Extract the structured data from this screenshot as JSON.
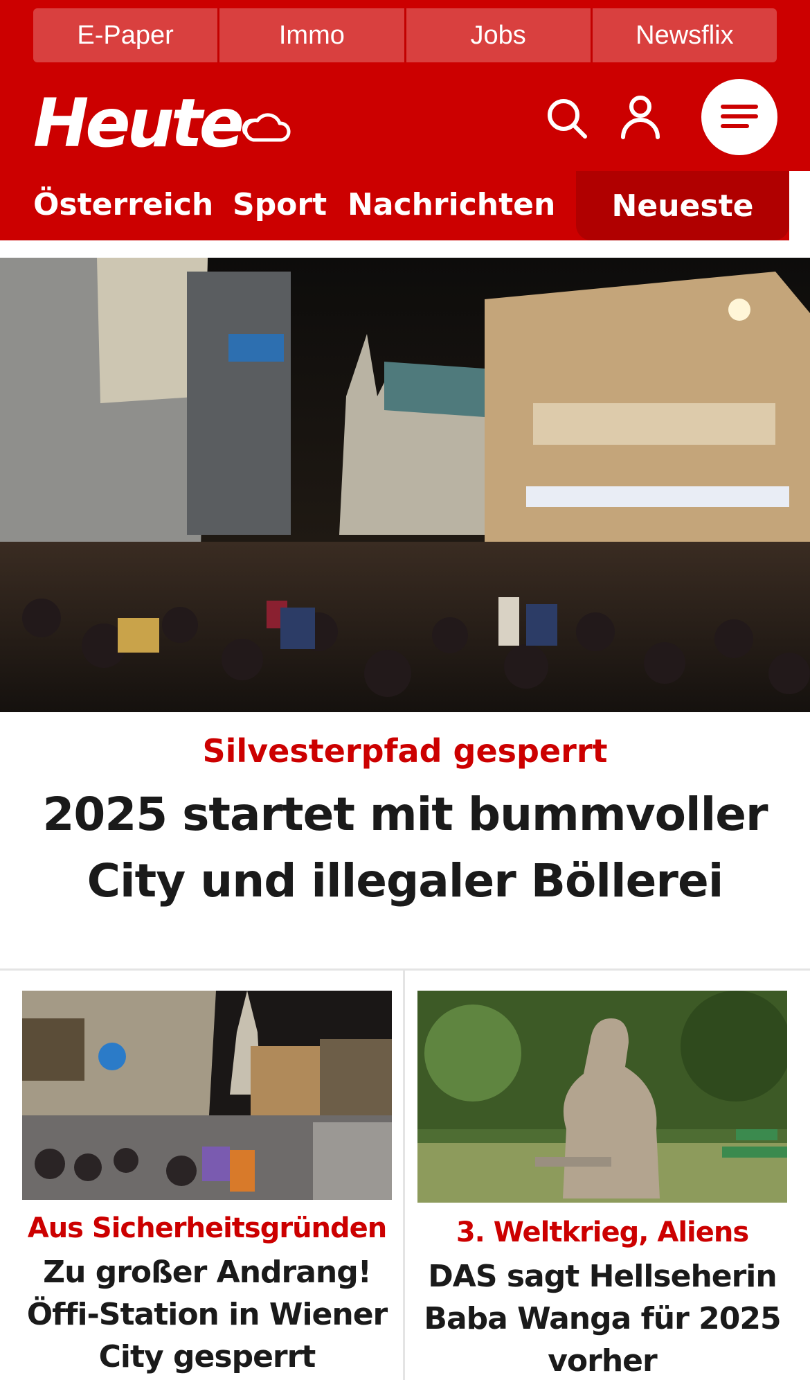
{
  "utility_links": [
    "E-Paper",
    "Immo",
    "Jobs",
    "Newsflix"
  ],
  "brand": {
    "logo_text": "Heute"
  },
  "colors": {
    "brand_red": "#cc0000",
    "active_tab": "#b00000",
    "utility_tab": "#d9403f"
  },
  "icons": [
    "cloud-weather-icon",
    "search-icon",
    "user-icon",
    "hamburger-menu-icon"
  ],
  "nav": {
    "items": [
      "Österreich",
      "Sport",
      "Nachrichten"
    ],
    "active": "Neueste"
  },
  "hero": {
    "kicker": "Silvesterpfad gesperrt",
    "headline": "2025 startet mit bummvoller City und illegaler Böllerei"
  },
  "teasers": [
    {
      "kicker": "Aus Sicherheitsgründen",
      "headline": "Zu großer Andrang! Öffi-Station in Wiener City gesperrt"
    },
    {
      "kicker": "3. Weltkrieg, Aliens",
      "headline": "DAS sagt Hellseherin Baba Wanga für 2025 vorher"
    }
  ]
}
